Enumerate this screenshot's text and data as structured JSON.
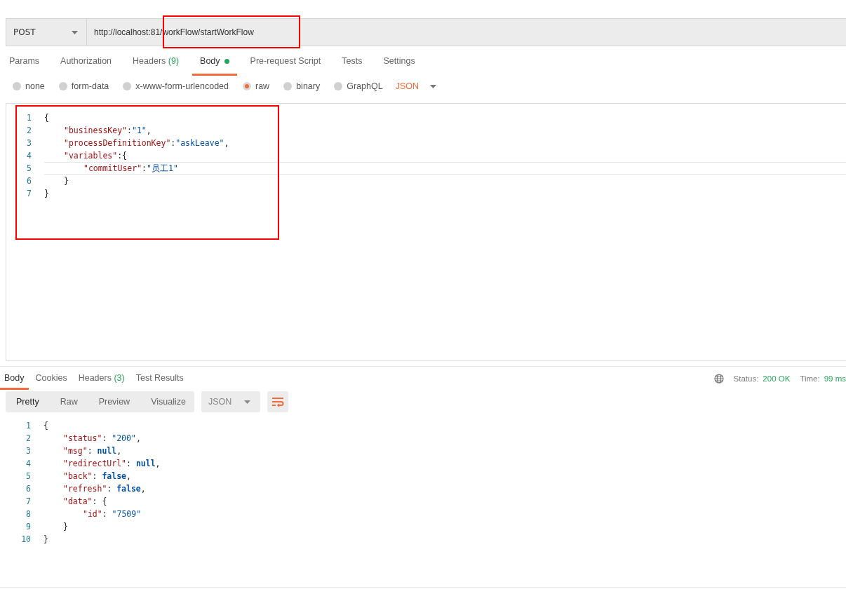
{
  "request": {
    "method": "POST",
    "url": "http://localhost:81/workFlow/startWorkFlow"
  },
  "request_tabs": [
    {
      "label": "Params",
      "selected": false
    },
    {
      "label": "Authorization",
      "selected": false
    },
    {
      "label": "Headers",
      "count": "(9)",
      "selected": false
    },
    {
      "label": "Body",
      "dot": true,
      "selected": true
    },
    {
      "label": "Pre-request Script",
      "selected": false
    },
    {
      "label": "Tests",
      "selected": false
    },
    {
      "label": "Settings",
      "selected": false
    }
  ],
  "body_types": [
    {
      "label": "none",
      "selected": false
    },
    {
      "label": "form-data",
      "selected": false
    },
    {
      "label": "x-www-form-urlencoded",
      "selected": false
    },
    {
      "label": "raw",
      "selected": true
    },
    {
      "label": "binary",
      "selected": false
    },
    {
      "label": "GraphQL",
      "selected": false
    }
  ],
  "raw_format": "JSON",
  "request_body": [
    {
      "num": "1",
      "current": false,
      "tokens": [
        {
          "kind": "punct",
          "text": "{"
        }
      ],
      "children": [
        {
          "num": "2",
          "current": false,
          "tokens": [
            {
              "kind": "key",
              "text": "\"businessKey\""
            },
            {
              "kind": "punct",
              "text": ":"
            },
            {
              "kind": "str",
              "text": "\"1\""
            },
            {
              "kind": "punct",
              "text": ","
            }
          ]
        },
        {
          "num": "3",
          "current": false,
          "tokens": [
            {
              "kind": "key",
              "text": "\"processDefinitionKey\""
            },
            {
              "kind": "punct",
              "text": ":"
            },
            {
              "kind": "str",
              "text": "\"askLeave\""
            },
            {
              "kind": "punct",
              "text": ","
            }
          ]
        },
        {
          "num": "4",
          "current": false,
          "tokens": [
            {
              "kind": "key",
              "text": "\"variables\""
            },
            {
              "kind": "punct",
              "text": ":{"
            }
          ],
          "children": [
            {
              "num": "5",
              "current": true,
              "tokens": [
                {
                  "kind": "key",
                  "text": "\"commitUser\""
                },
                {
                  "kind": "punct",
                  "text": ":"
                },
                {
                  "kind": "str",
                  "text": "\"员工1\""
                }
              ]
            }
          ]
        },
        {
          "num": "6",
          "current": false,
          "tokens": [
            {
              "kind": "punct",
              "text": "}"
            }
          ]
        }
      ]
    },
    {
      "num": "7",
      "current": false,
      "tokens": [
        {
          "kind": "punct",
          "text": "}"
        }
      ]
    }
  ],
  "response_tabs": [
    {
      "label": "Body",
      "selected": true
    },
    {
      "label": "Cookies",
      "selected": false
    },
    {
      "label": "Headers",
      "count": "(3)",
      "selected": false
    },
    {
      "label": "Test Results",
      "selected": false
    }
  ],
  "status": {
    "status_label": "Status:",
    "status_value": "200 OK",
    "time_label": "Time:",
    "time_value": "99 ms"
  },
  "view_modes": [
    {
      "label": "Pretty",
      "selected": true
    },
    {
      "label": "Raw",
      "selected": false
    },
    {
      "label": "Preview",
      "selected": false
    },
    {
      "label": "Visualize",
      "selected": false
    }
  ],
  "response_format": "JSON",
  "response_body": [
    {
      "num": "1",
      "current": false,
      "tokens": [
        {
          "kind": "punct",
          "text": "{"
        }
      ],
      "children": [
        {
          "num": "2",
          "current": false,
          "tokens": [
            {
              "kind": "key",
              "text": "\"status\""
            },
            {
              "kind": "punct",
              "text": ": "
            },
            {
              "kind": "str",
              "text": "\"200\""
            },
            {
              "kind": "punct",
              "text": ","
            }
          ]
        },
        {
          "num": "3",
          "current": false,
          "tokens": [
            {
              "kind": "key",
              "text": "\"msg\""
            },
            {
              "kind": "punct",
              "text": ": "
            },
            {
              "kind": "kw",
              "text": "null"
            },
            {
              "kind": "punct",
              "text": ","
            }
          ]
        },
        {
          "num": "4",
          "current": false,
          "tokens": [
            {
              "kind": "key",
              "text": "\"redirectUrl\""
            },
            {
              "kind": "punct",
              "text": ": "
            },
            {
              "kind": "kw",
              "text": "null"
            },
            {
              "kind": "punct",
              "text": ","
            }
          ]
        },
        {
          "num": "5",
          "current": false,
          "tokens": [
            {
              "kind": "key",
              "text": "\"back\""
            },
            {
              "kind": "punct",
              "text": ": "
            },
            {
              "kind": "kw",
              "text": "false"
            },
            {
              "kind": "punct",
              "text": ","
            }
          ]
        },
        {
          "num": "6",
          "current": false,
          "tokens": [
            {
              "kind": "key",
              "text": "\"refresh\""
            },
            {
              "kind": "punct",
              "text": ": "
            },
            {
              "kind": "kw",
              "text": "false"
            },
            {
              "kind": "punct",
              "text": ","
            }
          ]
        },
        {
          "num": "7",
          "current": false,
          "tokens": [
            {
              "kind": "key",
              "text": "\"data\""
            },
            {
              "kind": "punct",
              "text": ": {"
            }
          ],
          "children": [
            {
              "num": "8",
              "current": false,
              "tokens": [
                {
                  "kind": "key",
                  "text": "\"id\""
                },
                {
                  "kind": "punct",
                  "text": ": "
                },
                {
                  "kind": "str",
                  "text": "\"7509\""
                }
              ]
            }
          ]
        },
        {
          "num": "9",
          "current": false,
          "tokens": [
            {
              "kind": "punct",
              "text": "}"
            }
          ]
        }
      ]
    },
    {
      "num": "10",
      "current": false,
      "tokens": [
        {
          "kind": "punct",
          "text": "}"
        }
      ]
    }
  ]
}
